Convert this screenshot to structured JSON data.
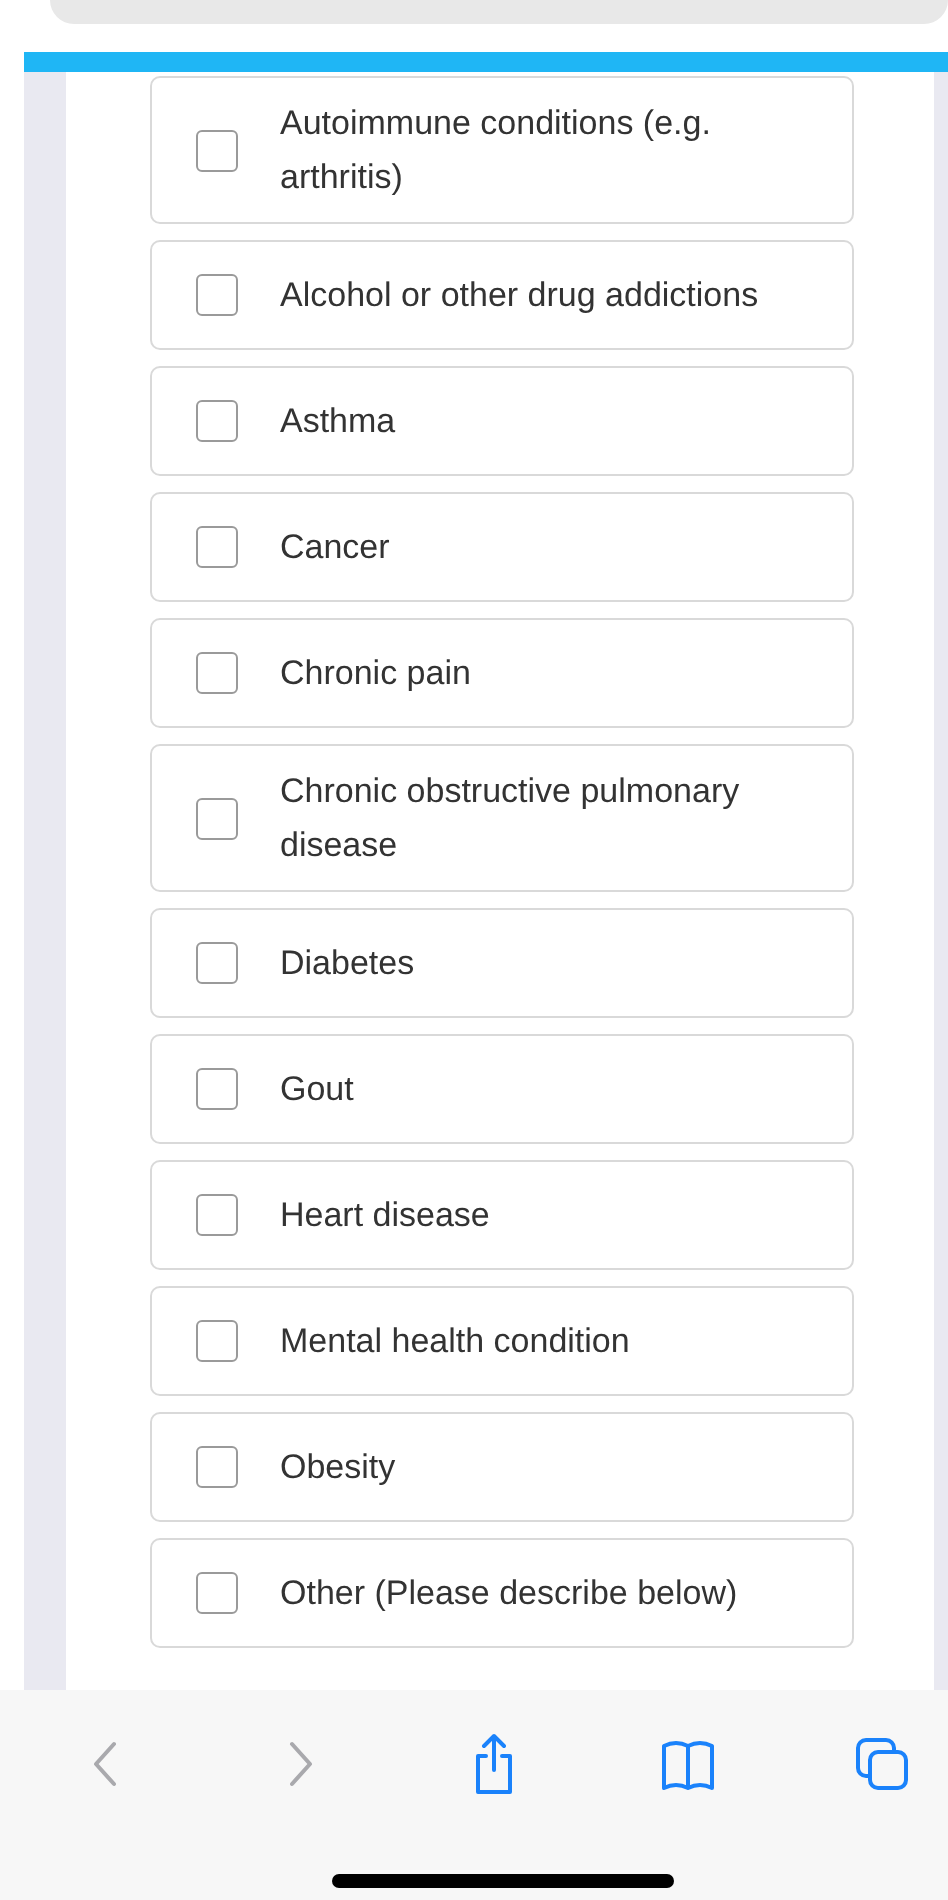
{
  "conditions": [
    {
      "label": "Autoimmune conditions (e.g. arthritis)",
      "checked": false
    },
    {
      "label": "Alcohol or other drug addictions",
      "checked": false
    },
    {
      "label": "Asthma",
      "checked": false
    },
    {
      "label": "Cancer",
      "checked": false
    },
    {
      "label": "Chronic pain",
      "checked": false
    },
    {
      "label": "Chronic obstructive pulmonary disease",
      "checked": false
    },
    {
      "label": "Diabetes",
      "checked": false
    },
    {
      "label": "Gout",
      "checked": false
    },
    {
      "label": "Heart disease",
      "checked": false
    },
    {
      "label": "Mental health condition",
      "checked": false
    },
    {
      "label": "Obesity",
      "checked": false
    },
    {
      "label": "Other (Please describe below)",
      "checked": false
    }
  ],
  "toolbar": [
    {
      "kind": "back",
      "disabled": true
    },
    {
      "kind": "forward",
      "disabled": true
    },
    {
      "kind": "share",
      "disabled": false
    },
    {
      "kind": "bookmarks",
      "disabled": false
    },
    {
      "kind": "tabs",
      "disabled": false
    }
  ]
}
